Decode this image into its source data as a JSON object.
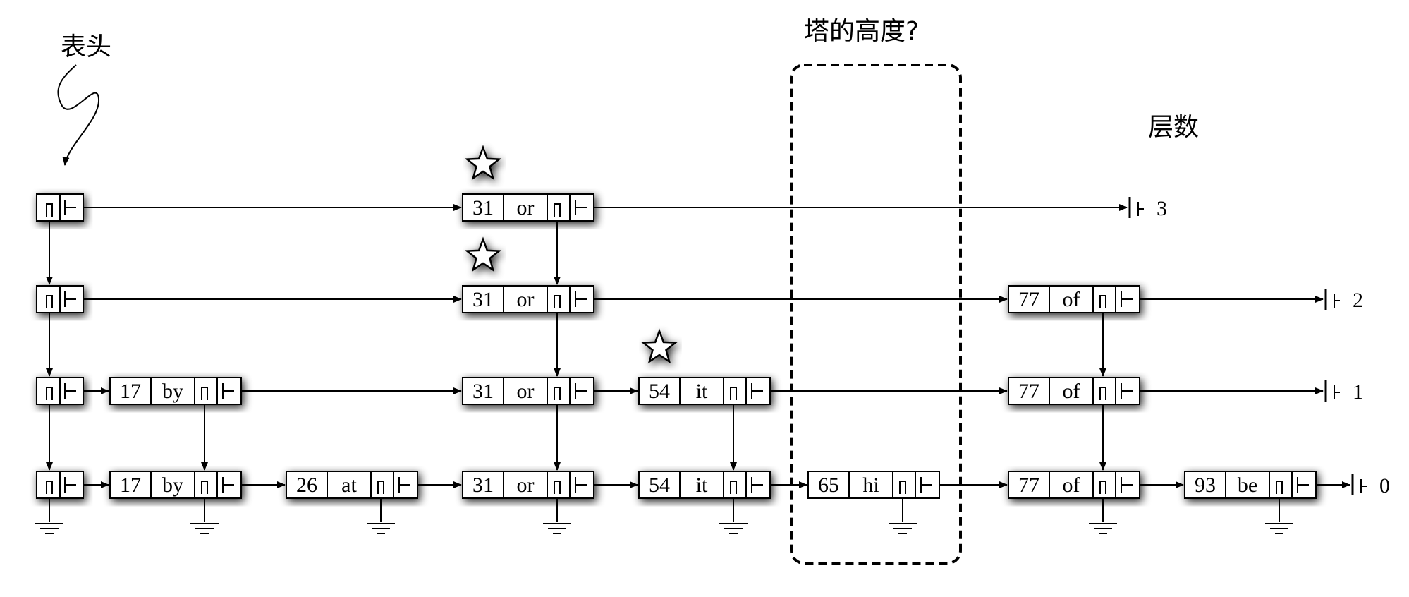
{
  "labels": {
    "header": "表头",
    "tower_height": "塔的高度?",
    "levels": "层数"
  },
  "level_numbers": [
    "3",
    "2",
    "1",
    "0"
  ],
  "nodes": [
    {
      "key": "17",
      "word": "by",
      "height": 2
    },
    {
      "key": "26",
      "word": "at",
      "height": 1
    },
    {
      "key": "31",
      "word": "or",
      "height": 4
    },
    {
      "key": "54",
      "word": "it",
      "height": 2
    },
    {
      "key": "65",
      "word": "hi",
      "height": 1
    },
    {
      "key": "77",
      "word": "of",
      "height": 3
    },
    {
      "key": "93",
      "word": "be",
      "height": 1
    }
  ]
}
